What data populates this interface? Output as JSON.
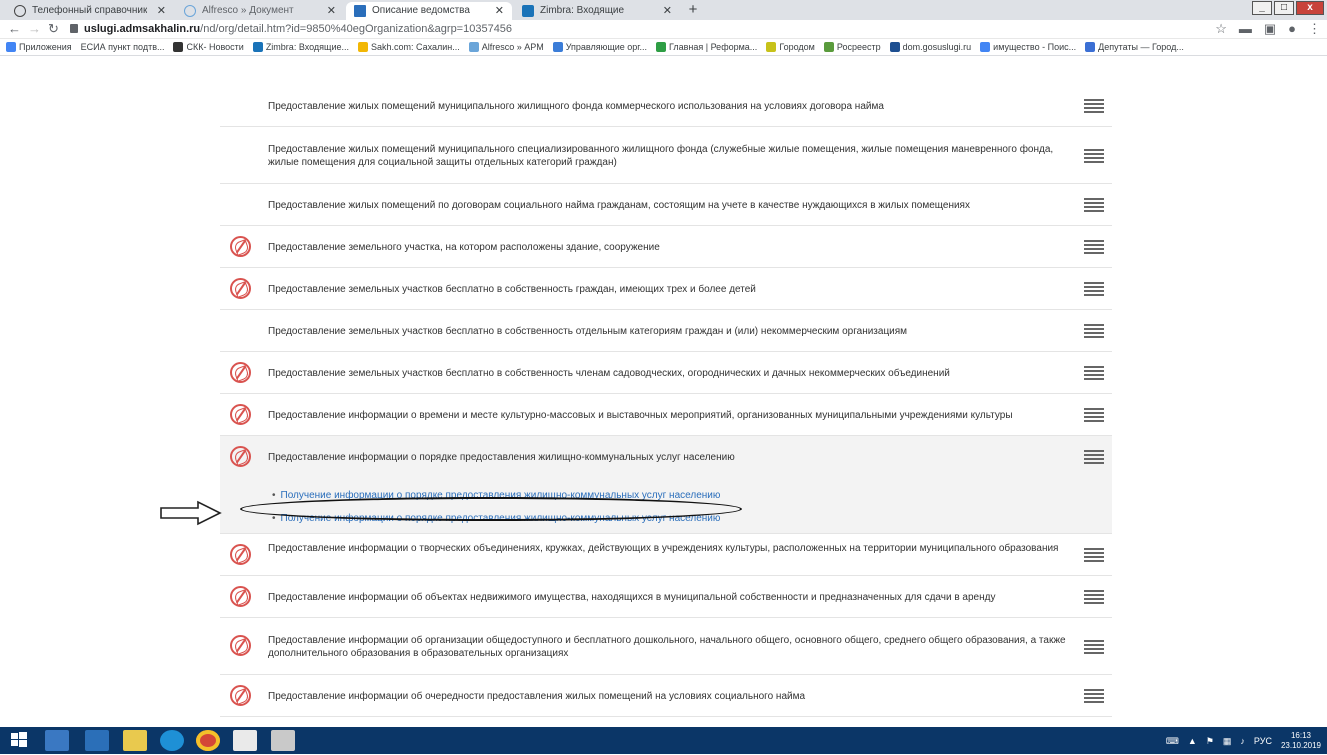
{
  "browser": {
    "tabs": [
      {
        "label": "Телефонный справочник",
        "active": false
      },
      {
        "label": "Alfresco » Документ",
        "active": false
      },
      {
        "label": "Описание ведомства",
        "active": true
      },
      {
        "label": "Zimbra: Входящие",
        "active": false
      }
    ],
    "new_tab": "+",
    "window_controls": {
      "minimize": "_",
      "maximize": "□",
      "close": "x"
    },
    "address": {
      "host": "uslugi.admsakhalin.ru",
      "path": "/nd/org/detail.htm?id=9850%40egOrganization&agrp=10357456"
    },
    "bookmarks": [
      {
        "label": "Приложения",
        "color": "#4285f4"
      },
      {
        "label": "ЕСИА пункт подтв...",
        "color": "#ffffff"
      },
      {
        "label": "СКК- Новости",
        "color": "#333333"
      },
      {
        "label": "Zimbra: Входящие...",
        "color": "#1a73b8"
      },
      {
        "label": "Sakh.com: Сахалин...",
        "color": "#f2b705"
      },
      {
        "label": "Alfresco » АРМ",
        "color": "#6aa5d9"
      },
      {
        "label": "Управляющие орг...",
        "color": "#3b7dd8"
      },
      {
        "label": "Главная | Реформа...",
        "color": "#2e9e44"
      },
      {
        "label": "Городом",
        "color": "#c7c21a"
      },
      {
        "label": "Росреестр",
        "color": "#5a9b3c"
      },
      {
        "label": "dom.gosuslugi.ru",
        "color": "#1d4f91"
      },
      {
        "label": "имущество - Поис...",
        "color": "#4285f4"
      },
      {
        "label": "Депутаты — Город...",
        "color": "#3b6fd4"
      }
    ]
  },
  "services": [
    {
      "text": "Предоставление жилых помещений муниципального жилищного фонда коммерческого использования на условиях договора найма",
      "emblem": false
    },
    {
      "text": "Предоставление жилых помещений муниципального специализированного жилищного фонда (служебные жилые помещения, жилые помещения маневренного фонда, жилые помещения для социальной защиты отдельных категорий граждан)",
      "emblem": false
    },
    {
      "text": "Предоставление жилых помещений по договорам социального найма гражданам, состоящим на учете в качестве нуждающихся в жилых помещениях",
      "emblem": false
    },
    {
      "text": "Предоставление земельного участка, на котором расположены здание, сооружение",
      "emblem": true
    },
    {
      "text": "Предоставление земельных участков бесплатно в собственность граждан, имеющих трех и более детей",
      "emblem": true
    },
    {
      "text": "Предоставление земельных участков бесплатно в собственность отдельным категориям граждан и (или) некоммерческим организациям",
      "emblem": false
    },
    {
      "text": "Предоставление земельных участков бесплатно в собственность членам садоводческих, огороднических и дачных некоммерческих объединений",
      "emblem": true
    },
    {
      "text": "Предоставление информации о времени и месте культурно-массовых и выставочных мероприятий, организованных муниципальными учреждениями культуры",
      "emblem": true
    },
    {
      "text": "Предоставление информации о порядке предоставления жилищно-коммунальных услуг населению",
      "emblem": true,
      "subitems": [
        "Получение информации о порядке предоставления жилищно-коммунальных услуг населению",
        "Получение информации о порядке предоставления жилищно-коммунальных услуг населению"
      ]
    },
    {
      "text": "Предоставление информации о творческих объединениях, кружках, действующих в учреждениях культуры, расположенных на территории муниципального образования",
      "emblem": true
    },
    {
      "text": "Предоставление информации об объектах недвижимого имущества, находящихся в муниципальной собственности и предназначенных для сдачи в аренду",
      "emblem": true
    },
    {
      "text": "Предоставление информации об организации общедоступного и бесплатного дошкольного, начального общего, основного общего, среднего общего образования, а также дополнительного образования в образовательных организациях",
      "emblem": true
    },
    {
      "text": "Предоставление информации об очередности предоставления жилых помещений на условиях социального найма",
      "emblem": true
    }
  ],
  "taskbar": {
    "tray_lang": "РУС",
    "time": "16:13",
    "date": "23.10.2019"
  }
}
